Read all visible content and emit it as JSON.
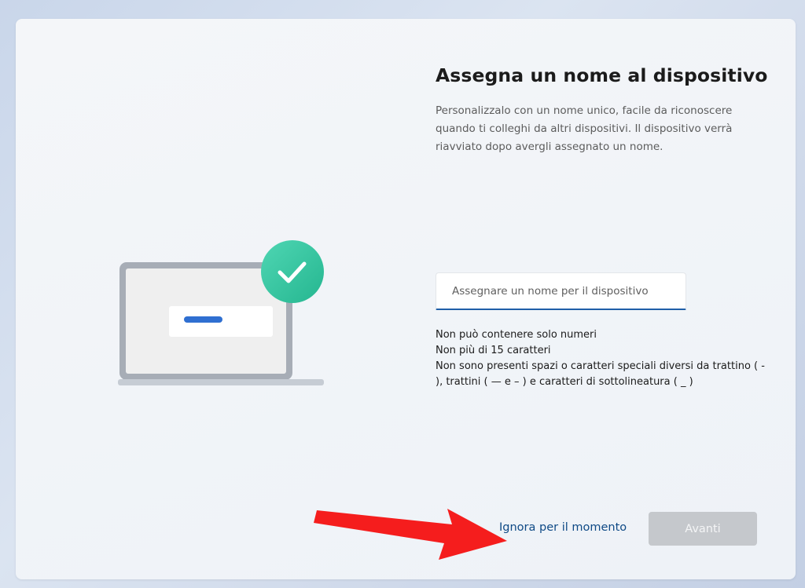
{
  "page": {
    "title": "Assegna un nome al dispositivo",
    "description": "Personalizzalo con un nome unico, facile da riconoscere quando ti colleghi da altri dispositivi. Il dispositivo verrà riavviato dopo avergli assegnato un nome."
  },
  "input": {
    "placeholder": "Assegnare un nome per il dispositivo",
    "value": ""
  },
  "rules": [
    "Non può contenere solo numeri",
    "Non più di 15 caratteri",
    "Non sono presenti spazi o caratteri speciali diversi da trattino ( - ), trattini ( — e – ) e caratteri di sottolineatura ( _ )"
  ],
  "actions": {
    "skip_label": "Ignora per il momento",
    "next_label": "Avanti",
    "next_enabled": false
  },
  "illustration": {
    "icons": [
      "laptop-icon",
      "checkmark-icon"
    ],
    "check_badge_color": "#3fc9a6",
    "progress_bar_color": "#2f6fd1"
  },
  "annotation": {
    "icon": "red-arrow-icon",
    "color": "#f51d1d"
  },
  "colors": {
    "link": "#0f4a86",
    "input_focus_border": "#1f5fa8",
    "disabled_button_bg": "#c5c8cc"
  }
}
